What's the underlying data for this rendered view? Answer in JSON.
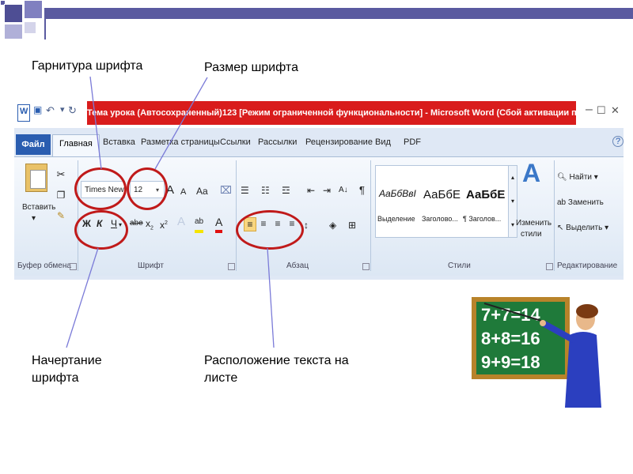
{
  "slide": {
    "captions": {
      "font_face": "Гарнитура шрифта",
      "font_size": "Размер шрифта",
      "font_style_line1": "Начертание",
      "font_style_line2": "шрифта",
      "text_layout_line1": "Расположение текста на",
      "text_layout_line2": "листе"
    },
    "colors": {
      "accent": "#5a5aa0",
      "highlight_oval": "#c01a1a",
      "title_bar": "#d91c1c",
      "file_tab": "#2a5db0"
    }
  },
  "word": {
    "title": "Тема урока (Автосохраненный)123 [Режим ограниченной функциональности] - Microsoft Word (Сбой активации продукта)",
    "qat": {
      "word_icon": "W",
      "undo": "↶",
      "redo": "↻",
      "customize": "▾"
    },
    "window_controls": {
      "minimize": "–",
      "maximize": "☐",
      "close": "✕"
    },
    "tabs": {
      "file": "Файл",
      "home": "Главная",
      "insert": "Вставка",
      "page_layout": "Разметка страницы",
      "references": "Ссылки",
      "mailings": "Рассылки",
      "review": "Рецензирование",
      "view": "Вид",
      "pdf": "PDF"
    },
    "help_icon": "?",
    "clipboard": {
      "paste": "Вставить",
      "group_label": "Буфер обмена"
    },
    "font": {
      "face_value": "Times New Ro",
      "size_value": "12",
      "grow": "A",
      "shrink": "A",
      "change_case": "Aa",
      "clear": "⌧",
      "bold": "Ж",
      "italic": "К",
      "underline": "Ч",
      "strike": "abe",
      "subscript": "x",
      "superscript": "x",
      "text_effects": "A",
      "highlight": "ab",
      "font_color": "A",
      "group_label": "Шрифт"
    },
    "paragraph": {
      "pilcrow": "¶",
      "sort": "A↓",
      "group_label": "Абзац"
    },
    "styles": {
      "items": [
        {
          "sample": "АаБбВвІ",
          "name": "Выделение"
        },
        {
          "sample": "АаБбЕ",
          "name": "Заголово..."
        },
        {
          "sample": "АаБбЕ",
          "name": "¶ Заголов..."
        }
      ],
      "change_styles_line1": "Изменить",
      "change_styles_line2": "стили",
      "group_label": "Стили"
    },
    "editing": {
      "find": "Найти",
      "replace": "Заменить",
      "select": "Выделить",
      "group_label": "Редактирование"
    }
  },
  "chalkboard": {
    "lines": [
      "7+7=14",
      "8+8=16",
      "9+9=18"
    ]
  }
}
